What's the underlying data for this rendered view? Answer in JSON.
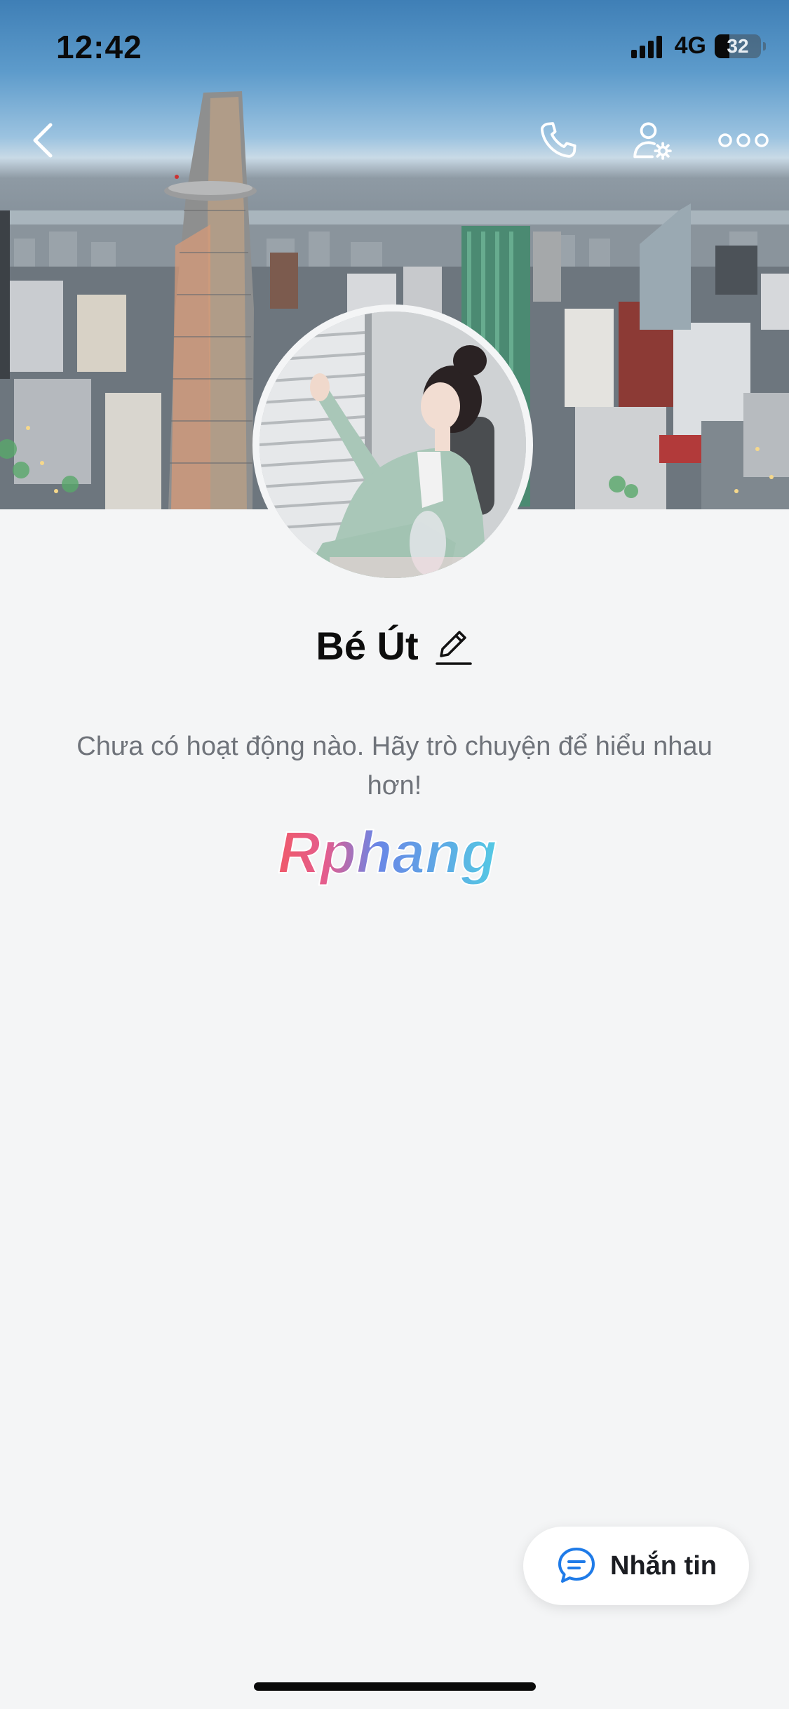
{
  "status_bar": {
    "time": "12:42",
    "network": "4G",
    "battery": "32",
    "battery_level": 0.32
  },
  "nav": {
    "back_icon": "chevron-left-icon",
    "call_icon": "phone-icon",
    "settings_icon": "user-settings-icon",
    "more_icon": "more-dots-icon"
  },
  "profile": {
    "name": "Bé Út",
    "empty_message": "Chưa có hoạt động nào. Hãy trò chuyện để hiểu nhau hơn!",
    "watermark": "Rphang"
  },
  "actions": {
    "message_label": "Nhắn tin",
    "message_icon": "chat-bubble-icon"
  },
  "colors": {
    "background": "#f4f5f6",
    "accent": "#1f7be8",
    "text_secondary": "#6f737a"
  }
}
